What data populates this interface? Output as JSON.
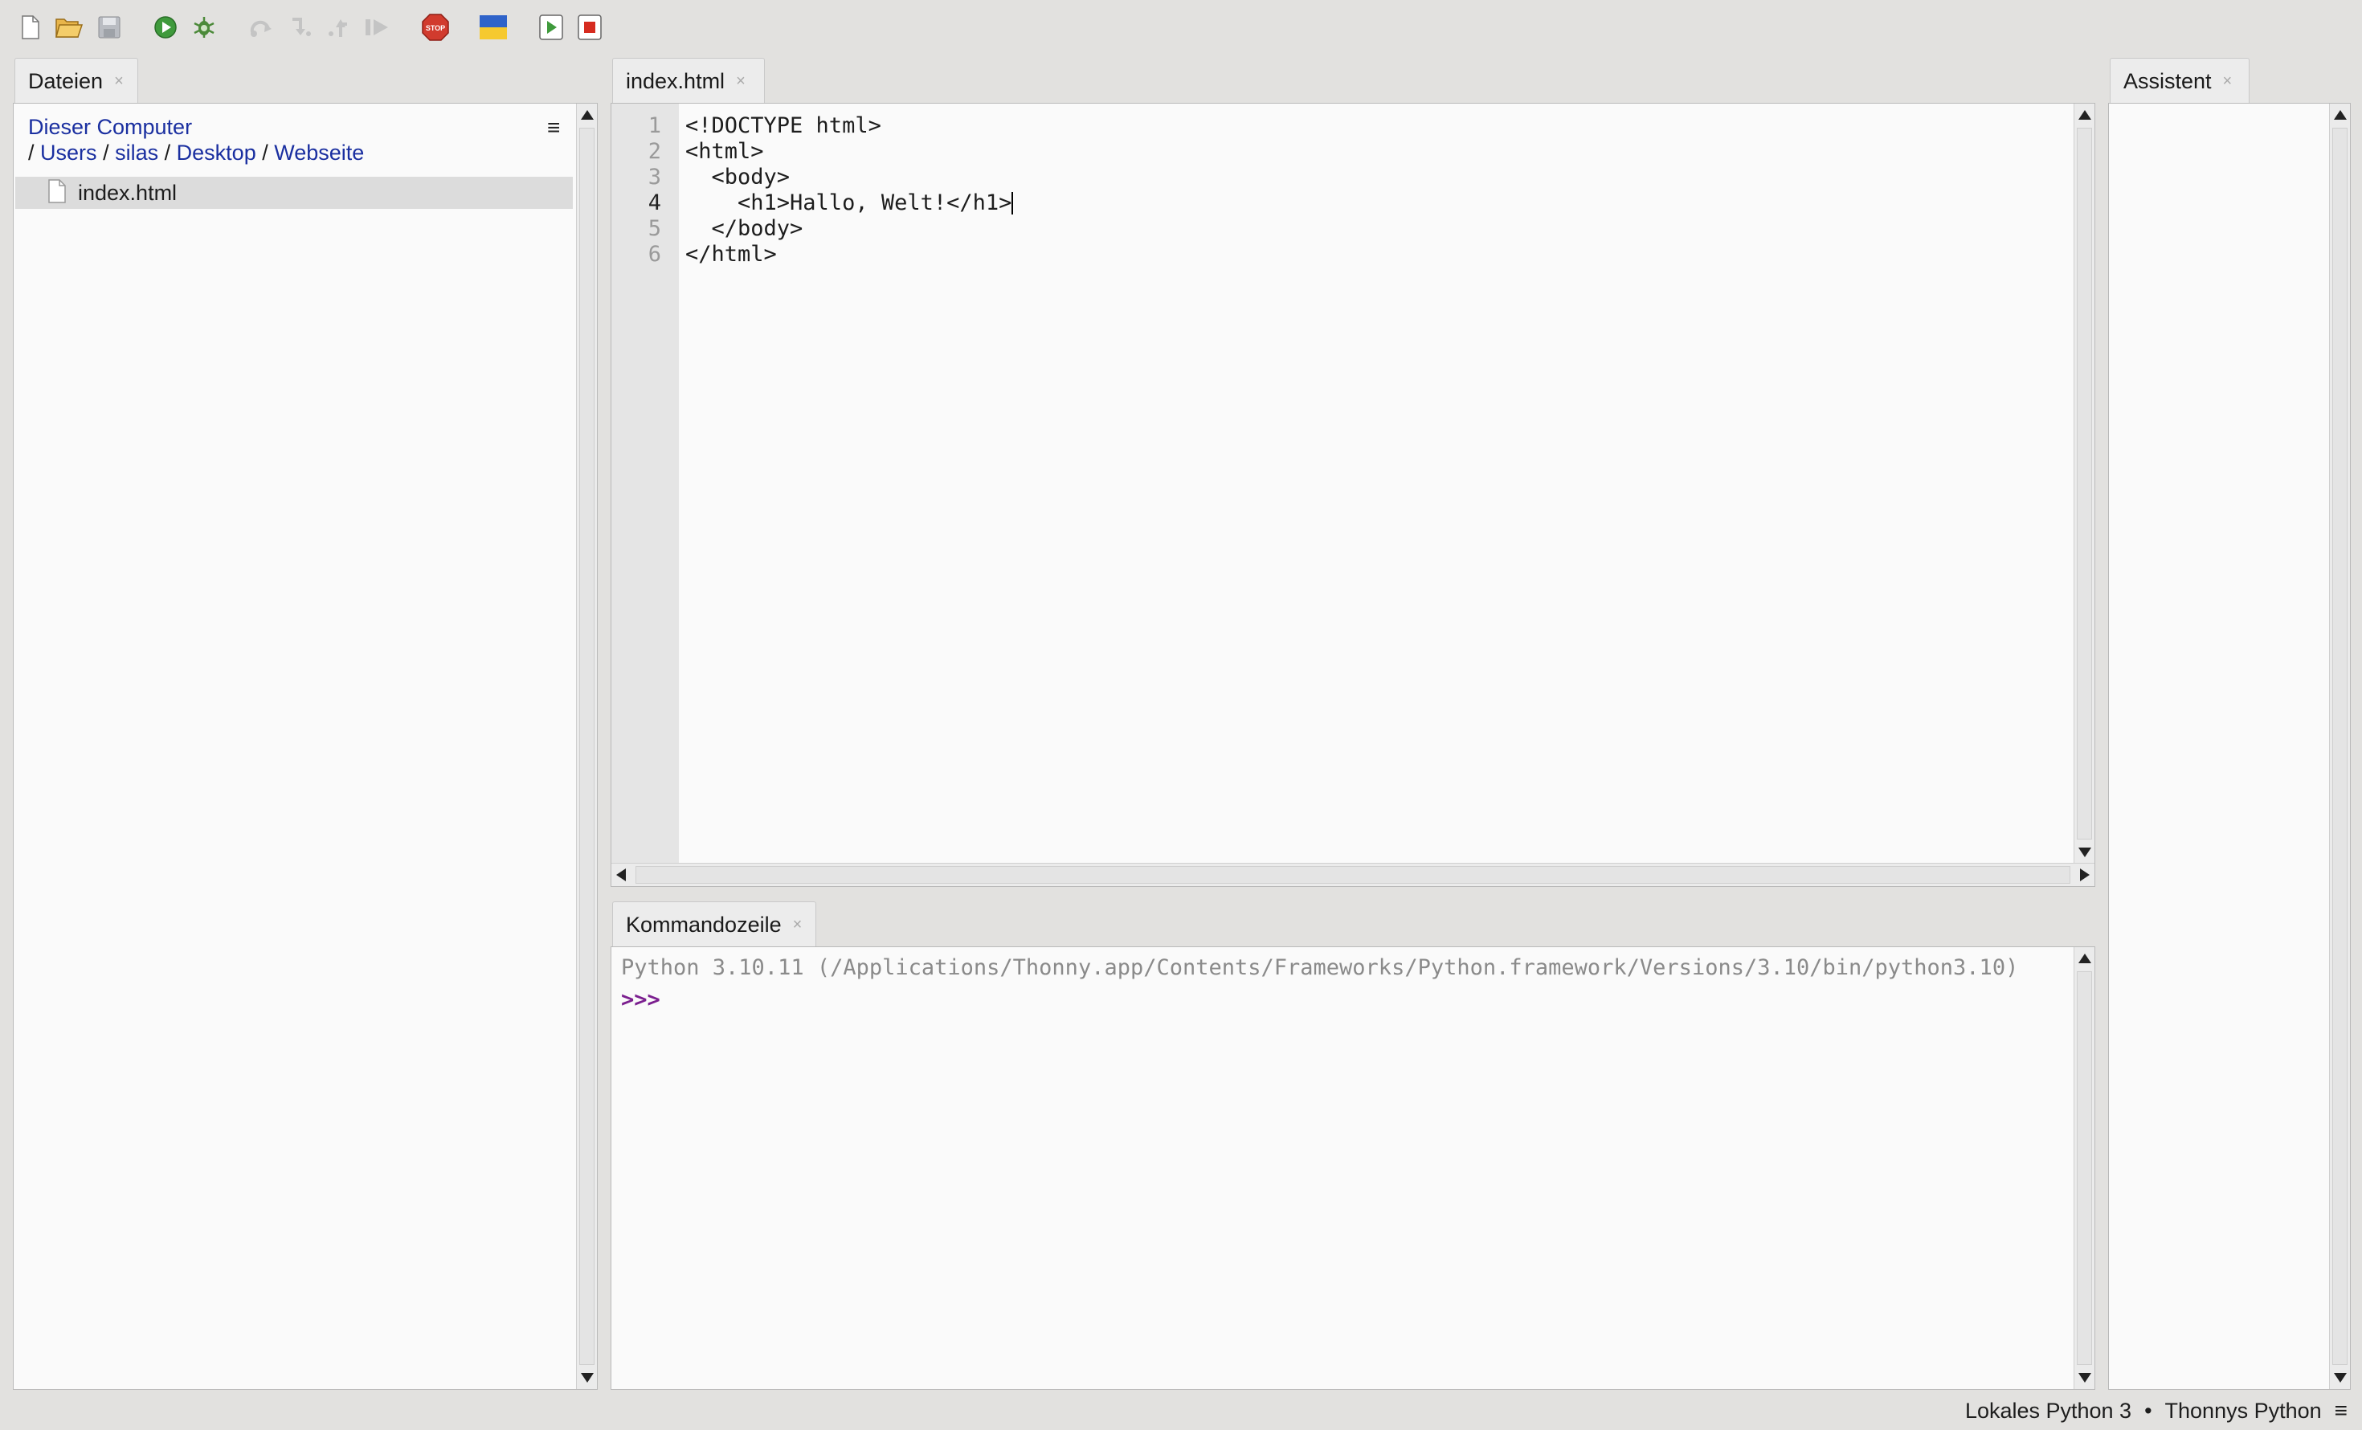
{
  "toolbar": {
    "icons": [
      "new-file-icon",
      "open-file-icon",
      "save-icon",
      "run-icon",
      "debug-icon",
      "step-over-icon",
      "step-into-icon",
      "step-out-icon",
      "resume-icon",
      "stop-icon",
      "ukraine-flag-icon",
      "run-current-icon",
      "stop-current-icon"
    ]
  },
  "files_panel": {
    "tab_label": "Dateien",
    "location": "Dieser Computer",
    "path": [
      "Users",
      "silas",
      "Desktop",
      "Webseite"
    ],
    "path_sep": "/",
    "items": [
      {
        "name": "index.html",
        "selected": true
      }
    ]
  },
  "editor": {
    "tab_label": "index.html",
    "line_numbers": [
      "1",
      "2",
      "3",
      "4",
      "5",
      "6"
    ],
    "lines": [
      "<!DOCTYPE html>",
      "<html>",
      "  <body>",
      "    <h1>Hallo, Welt!</h1>",
      "  </body>",
      "</html>"
    ],
    "current_line": 4
  },
  "shell": {
    "tab_label": "Kommandozeile",
    "banner": "Python 3.10.11 (/Applications/Thonny.app/Contents/Frameworks/Python.framework/Versions/3.10/bin/python3.10)",
    "prompt": ">>>"
  },
  "assistant": {
    "tab_label": "Assistent"
  },
  "statusbar": {
    "interpreter": "Lokales Python 3",
    "separator": "•",
    "app": "Thonnys Python"
  },
  "colors": {
    "link": "#1a2fa0",
    "prompt": "#7b1f8f",
    "banner": "#8a8a8a"
  }
}
